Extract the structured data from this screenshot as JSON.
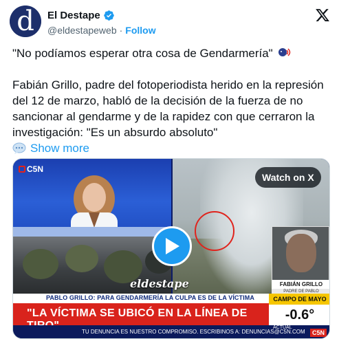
{
  "account": {
    "display_name": "El Destape",
    "handle": "@eldestapeweb",
    "separator": "·",
    "follow_label": "Follow",
    "avatar_letter": "d"
  },
  "tweet": {
    "line1": "\"No podíamos esperar otra cosa de Gendarmería\"",
    "body": "Fabián Grillo, padre del fotoperiodista herido en la represión del 12 de marzo, habló de la decisión de la fuerza de no sancionar al gendarme y de la rapidez con que cerraron la investigación: \"Es un absurdo absoluto\"",
    "show_more_label": "Show more"
  },
  "media": {
    "watch_label": "Watch on X",
    "channel_badge": "C5N",
    "watermark": "eldestape",
    "inset_name": "FABIÁN GRILLO",
    "inset_role": "PADRE DE PABLO",
    "chyron_top": "PABLO GRILLO: PARA GENDARMERÍA LA CULPA ES DE LA VÍCTIMA",
    "chyron_main": "\"LA VÍCTIMA SE UBICÓ EN LA LÍNEA DE TIRO\"",
    "ticker": "TU DENUNCIA ES NUESTRO COMPROMISO. ESCRIBINOS A: DENUNCIAS@C5N.COM",
    "weather_location": "CAMPO DE MAYO",
    "weather_temp": "-0.6°",
    "weather_sub": "ACTUAL",
    "corner_logo": "C5N"
  },
  "colors": {
    "accent": "#1d9bf0",
    "text": "#0f1419",
    "muted": "#536471",
    "chyron_red": "#d9231c",
    "weather_yellow": "#f6c600"
  },
  "icons": [
    "verified-badge-icon",
    "x-logo-icon",
    "speaking-head-icon",
    "speech-bubble-icon",
    "play-icon",
    "c5n-logo-icon"
  ]
}
